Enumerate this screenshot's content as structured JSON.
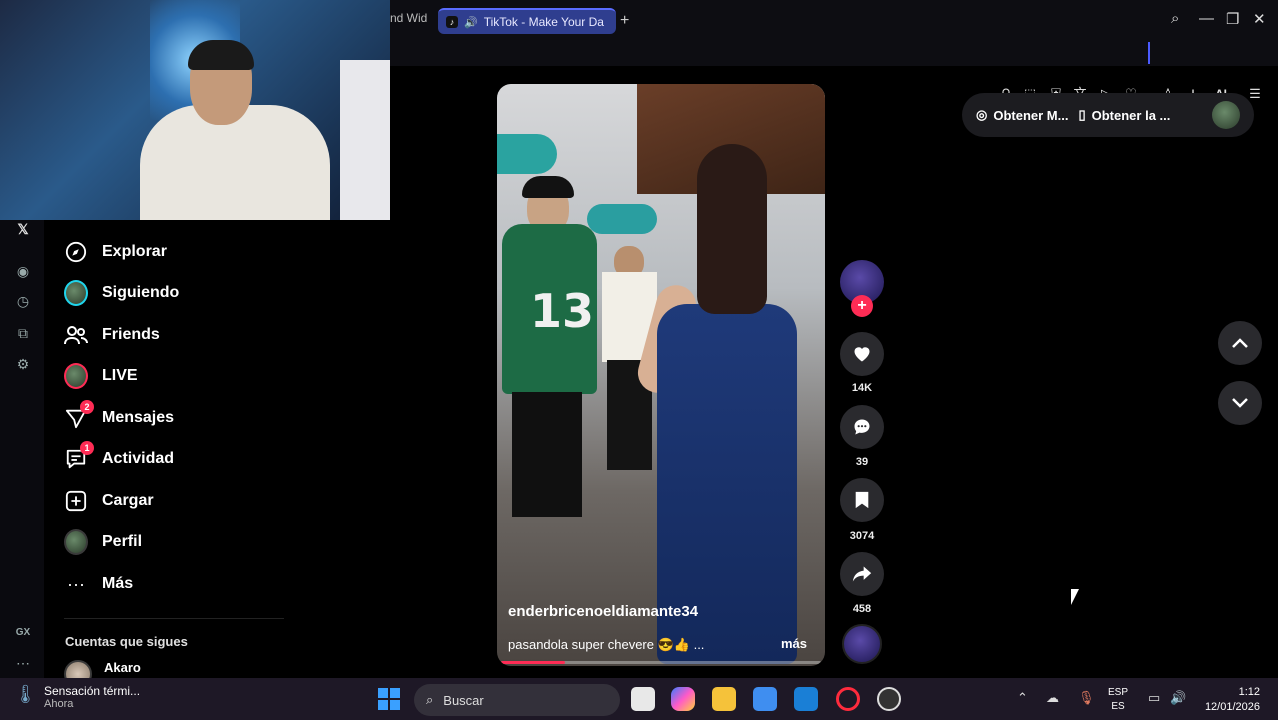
{
  "browser": {
    "tabs": [
      {
        "label": "nd Wid"
      },
      {
        "label": "TikTok - Make Your Da",
        "active": true
      }
    ],
    "new_tab_icon": "plus-icon",
    "toolbar_ai_label": "AI",
    "accent_color": "#4b5bff"
  },
  "nav": {
    "items": [
      {
        "label": "Explorar",
        "icon": "compass-icon"
      },
      {
        "label": "Siguiendo",
        "icon": "avatar"
      },
      {
        "label": "Friends",
        "icon": "friends-icon"
      },
      {
        "label": "LIVE",
        "icon": "avatar-live"
      },
      {
        "label": "Mensajes",
        "icon": "paper-plane-icon",
        "badge": "2"
      },
      {
        "label": "Actividad",
        "icon": "message-box-icon",
        "badge": "1"
      },
      {
        "label": "Cargar",
        "icon": "plus-box-icon"
      },
      {
        "label": "Perfil",
        "icon": "avatar"
      },
      {
        "label": "Más",
        "icon": "more-icon"
      }
    ],
    "following_title": "Cuentas que sigues",
    "following": [
      {
        "name": "Akaro"
      }
    ]
  },
  "video": {
    "author": "enderbricenoeldiamante34",
    "caption": "pasandola super chevere 😎👍 ...",
    "more_label": "más",
    "progress": 0.2
  },
  "actions": {
    "likes": "14K",
    "comments": "39",
    "saves": "3074",
    "shares": "458"
  },
  "get_app": {
    "item1": "Obtener M...",
    "item2": "Obtener la ..."
  },
  "taskbar": {
    "weather_title": "Sensación térmi...",
    "weather_sub": "Ahora",
    "search_label": "Buscar",
    "lang_top": "ESP",
    "lang_bottom": "ES",
    "time": "1:12",
    "date": "12/01/2026"
  },
  "colors": {
    "tiktok_red": "#fe2c55",
    "tiktok_cyan": "#20d5ec"
  }
}
